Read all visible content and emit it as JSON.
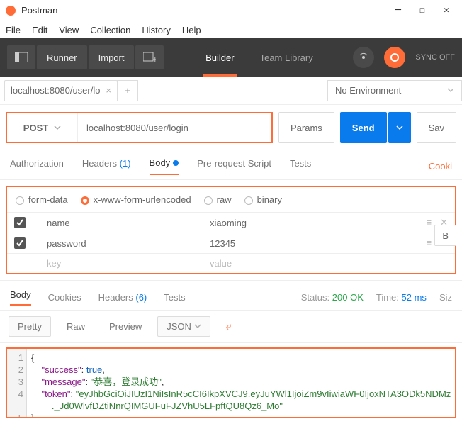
{
  "window": {
    "title": "Postman"
  },
  "menus": {
    "file": "File",
    "edit": "Edit",
    "view": "View",
    "collection": "Collection",
    "history": "History",
    "help": "Help"
  },
  "toolbar": {
    "runner": "Runner",
    "import": "Import",
    "builder": "Builder",
    "teamlib": "Team Library",
    "sync": "SYNC OFF"
  },
  "tabs": {
    "current": "localhost:8080/user/lo"
  },
  "environment": {
    "label": "No Environment"
  },
  "request": {
    "method": "POST",
    "url": "localhost:8080/user/login",
    "params_btn": "Params",
    "send_btn": "Send",
    "save_btn": "Sav"
  },
  "req_tabs": {
    "auth": "Authorization",
    "headers": "Headers",
    "headers_count": "(1)",
    "body": "Body",
    "prereq": "Pre-request Script",
    "tests": "Tests",
    "cookies": "Cooki"
  },
  "encoding": {
    "formdata": "form-data",
    "urlenc": "x-www-form-urlencoded",
    "raw": "raw",
    "binary": "binary",
    "selected": "urlenc"
  },
  "params_rows": [
    {
      "enabled": true,
      "key": "name",
      "value": "xiaoming"
    },
    {
      "enabled": true,
      "key": "password",
      "value": "12345"
    }
  ],
  "params_ph": {
    "key": "key",
    "value": "value"
  },
  "bulk": "B",
  "resp_tabs": {
    "body": "Body",
    "cookies": "Cookies",
    "headers": "Headers",
    "headers_count": "(6)",
    "tests": "Tests"
  },
  "resp_meta": {
    "status_lbl": "Status:",
    "status": "200 OK",
    "time_lbl": "Time:",
    "time": "52 ms",
    "size_lbl": "Siz"
  },
  "view": {
    "pretty": "Pretty",
    "raw": "Raw",
    "preview": "Preview",
    "lang": "JSON"
  },
  "response": {
    "success": true,
    "message": "恭喜，登录成功",
    "token_l1": "eyJhbGciOiJIUzI1NiIsInR5cCI6IkpXVCJ9.eyJuYWl1IjoiZm9vIiwiaWF0IjoxNTA3ODk5NDMz",
    "token_l2": "._Jd0WlvfDZtiNnrQIMGUFuFJZVhU5LFpftQU8Qz6_Mo"
  }
}
